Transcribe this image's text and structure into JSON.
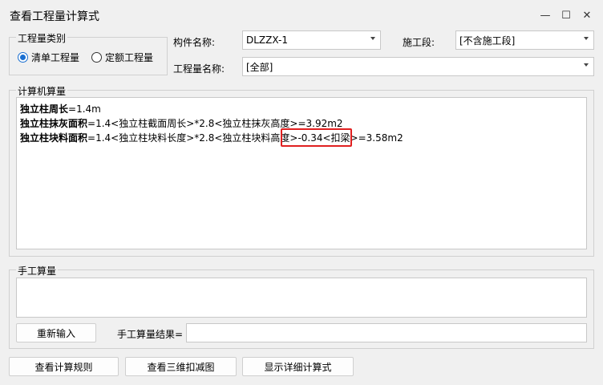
{
  "window": {
    "title": "查看工程量计算式",
    "minimize_glyph": "—",
    "maximize_glyph": "☐",
    "close_glyph": "✕"
  },
  "quantity_type": {
    "group_label": "工程量类别",
    "options": [
      {
        "label": "清单工程量",
        "checked": true
      },
      {
        "label": "定额工程量",
        "checked": false
      }
    ]
  },
  "fields": {
    "component_name_label": "构件名称:",
    "component_name_value": "DLZZX-1",
    "construction_stage_label": "施工段:",
    "construction_stage_value": "[不含施工段]",
    "quantity_name_label": "工程量名称:",
    "quantity_name_value": "[全部]"
  },
  "computer_calc": {
    "group_label": "计算机算量",
    "lines": [
      {
        "name": "独立柱周长",
        "formula": "=1.4m"
      },
      {
        "name": "独立柱抹灰面积",
        "formula": "=1.4<独立柱截面周长>*2.8<独立柱抹灰高度>=3.92m2"
      },
      {
        "name": "独立柱块料面积",
        "formula": "=1.4<独立柱块料长度>*2.8<独立柱块料高度>-0.34<扣梁>=3.58m2"
      }
    ]
  },
  "manual_calc": {
    "group_label": "手工算量",
    "reinput_button": "重新输入",
    "result_label": "手工算量结果=",
    "result_value": ""
  },
  "bottom_buttons": {
    "view_rules": "查看计算规则",
    "view_3d": "查看三维扣减图",
    "show_detail": "显示详细计算式"
  }
}
